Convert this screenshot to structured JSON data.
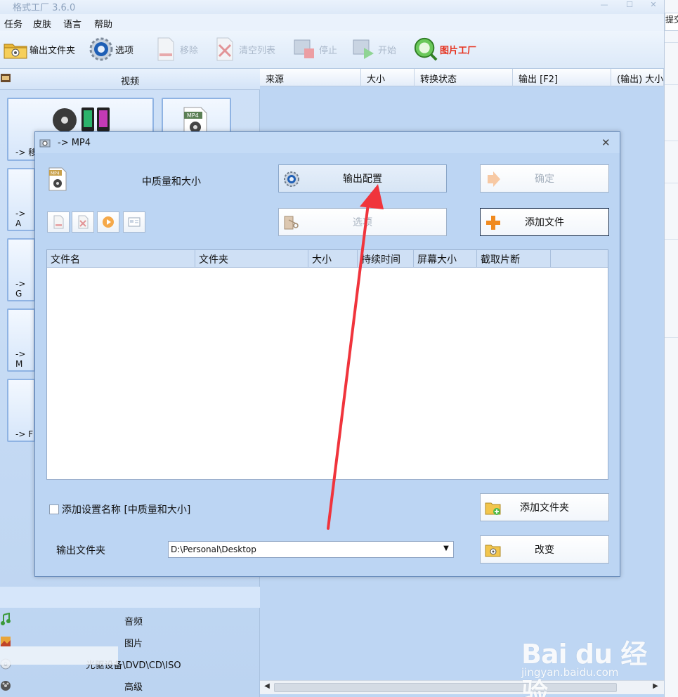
{
  "window": {
    "title": "格式工厂 3.6.0",
    "right_edge_tab": "提交"
  },
  "menu": [
    "任务",
    "皮肤",
    "语言",
    "帮助"
  ],
  "toolbar": {
    "output_folder": "输出文件夹",
    "options": "选项",
    "remove": "移除",
    "clear_list": "清空列表",
    "stop": "停止",
    "start": "开始",
    "picture_factory": "图片工厂"
  },
  "left_panel": {
    "video_category": "视频",
    "tiles": [
      "-> 移",
      "",
      "-> A",
      "-> G",
      "-> M",
      "-> F"
    ],
    "categories": {
      "audio": "音频",
      "picture": "图片",
      "rom": "光驱设备\\DVD\\CD\\ISO",
      "advanced": "高级"
    }
  },
  "list": {
    "columns": [
      "来源",
      "大小",
      "转换状态",
      "输出 [F2]",
      "(输出) 大小"
    ]
  },
  "dialog": {
    "title": "-> MP4",
    "quality": "中质量和大小",
    "output_config": "输出配置",
    "ok": "确定",
    "options": "选项",
    "add_file": "添加文件",
    "columns": [
      "文件名",
      "文件夹",
      "大小",
      "持续时间",
      "屏幕大小",
      "截取片断"
    ],
    "add_setting_name": "添加设置名称 [中质量和大小]",
    "add_folder": "添加文件夹",
    "output_folder_label": "输出文件夹",
    "output_folder_value": "D:\\Personal\\Desktop",
    "change": "改变"
  },
  "watermark": {
    "brand": "Bai du 经验",
    "url": "jingyan.baidu.com"
  },
  "colors": {
    "panel": "#bcd4f1",
    "annotation_arrow": "#f0343c",
    "picture_factory": "#e6301c"
  }
}
